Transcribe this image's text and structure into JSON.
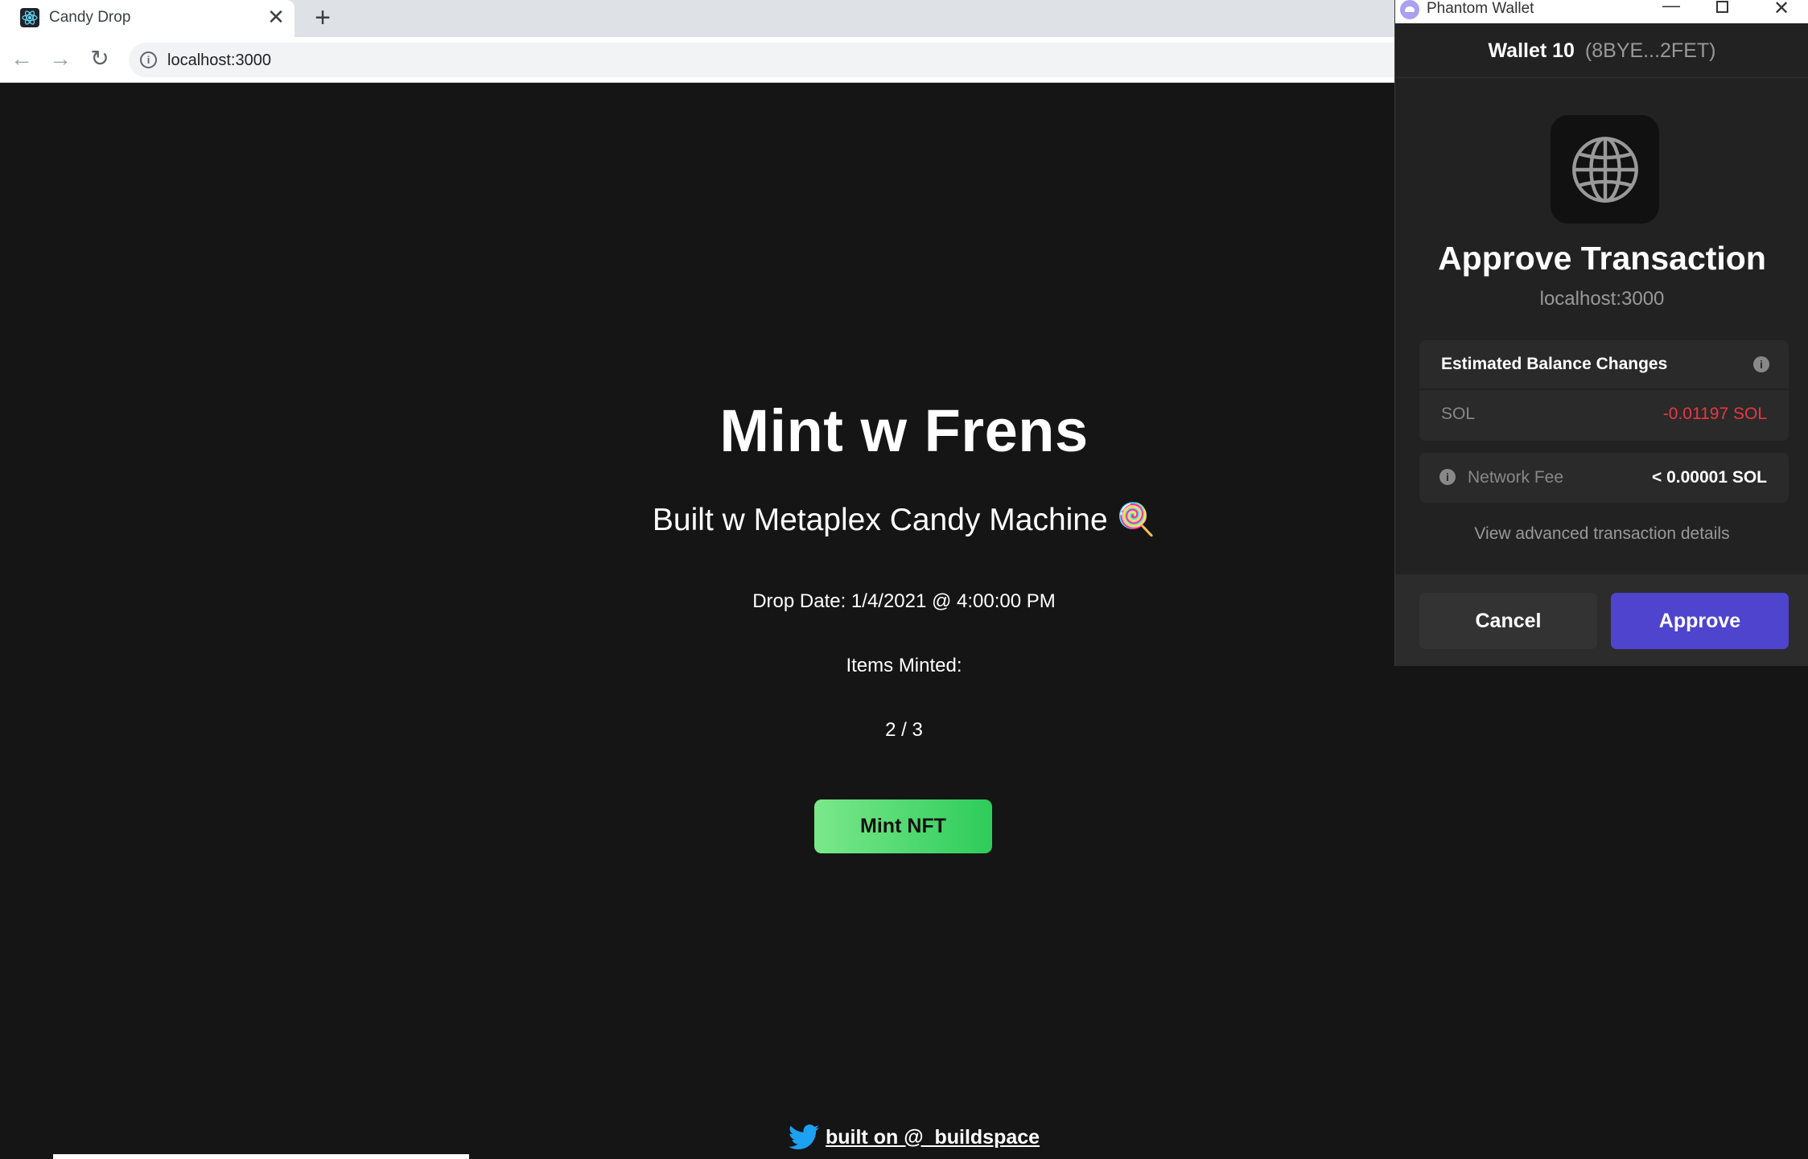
{
  "browser": {
    "tab_title": "Candy Drop",
    "tab_close": "✕",
    "new_tab": "+",
    "back": "←",
    "forward": "→",
    "reload": "↻",
    "url": "localhost:3000"
  },
  "page": {
    "title": "Mint w Frens",
    "subtitle": "Built w Metaplex Candy Machine 🍭",
    "drop_date": "Drop Date: 1/4/2021 @ 4:00:00 PM",
    "items_minted_label": "Items Minted:",
    "items_minted_count": "2 / 3",
    "mint_button": "Mint NFT",
    "footer_link": "built on @_buildspace"
  },
  "wallet": {
    "window_title": "Phantom Wallet",
    "wallet_name": "Wallet 10",
    "wallet_address": "(8BYE...2FET)",
    "heading": "Approve Transaction",
    "origin": "localhost:3000",
    "balance_changes_title": "Estimated Balance Changes",
    "sol_label": "SOL",
    "sol_change": "-0.01197 SOL",
    "network_fee_label": "Network Fee",
    "network_fee_value": "< 0.00001 SOL",
    "advanced_details": "View advanced transaction details",
    "cancel_button": "Cancel",
    "approve_button": "Approve"
  },
  "colors": {
    "page_bg": "#151515",
    "mint_gradient_start": "#7be88b",
    "mint_gradient_end": "#2dcc5a",
    "approve_bg": "#4e44ce",
    "negative": "#eb3742"
  }
}
